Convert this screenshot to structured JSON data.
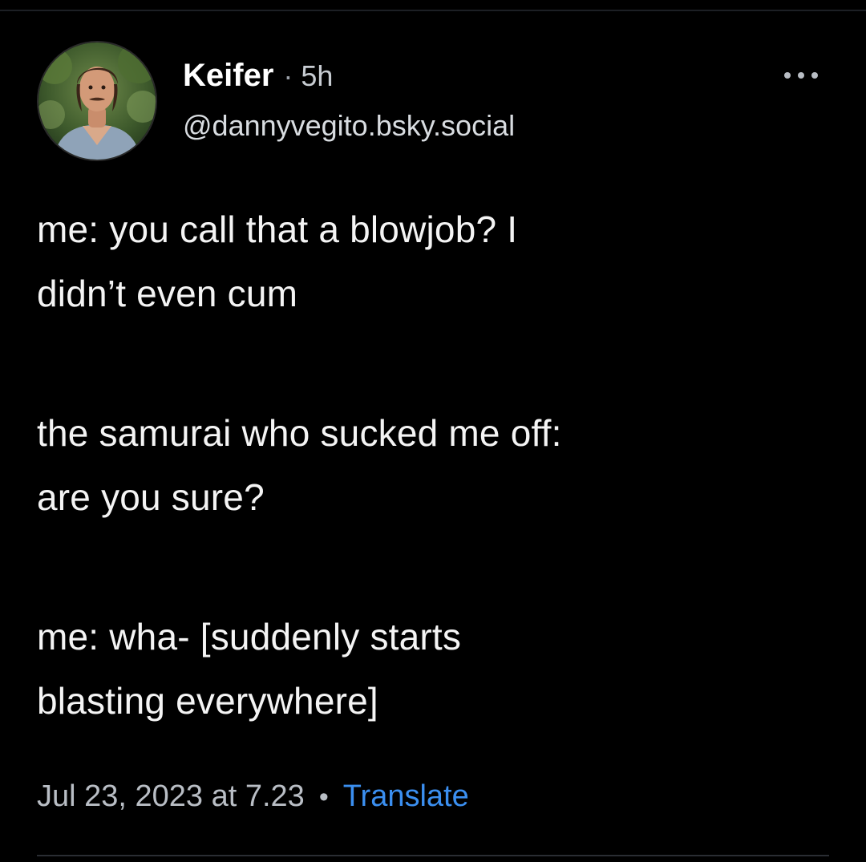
{
  "post": {
    "author": {
      "display_name": "Keifer",
      "separator": "·",
      "relative_time": "5h",
      "handle": "@dannyvegito.bsky.social",
      "avatar_icon": "avatar-photo"
    },
    "more_icon": "more-horizontal-icon",
    "body": [
      [
        "me: you call that a blowjob? I",
        "didn’t even cum"
      ],
      [
        "the samurai who sucked me off:",
        "are you sure?"
      ],
      [
        "me: wha- [suddenly starts",
        "blasting everywhere]"
      ]
    ],
    "meta": {
      "date": "Jul 23, 2023 at 7.23",
      "separator": "•",
      "translate_label": "Translate"
    }
  },
  "colors": {
    "background": "#000000",
    "text": "#f4f4f4",
    "muted": "#b9bec5",
    "link": "#3b8ff0"
  }
}
